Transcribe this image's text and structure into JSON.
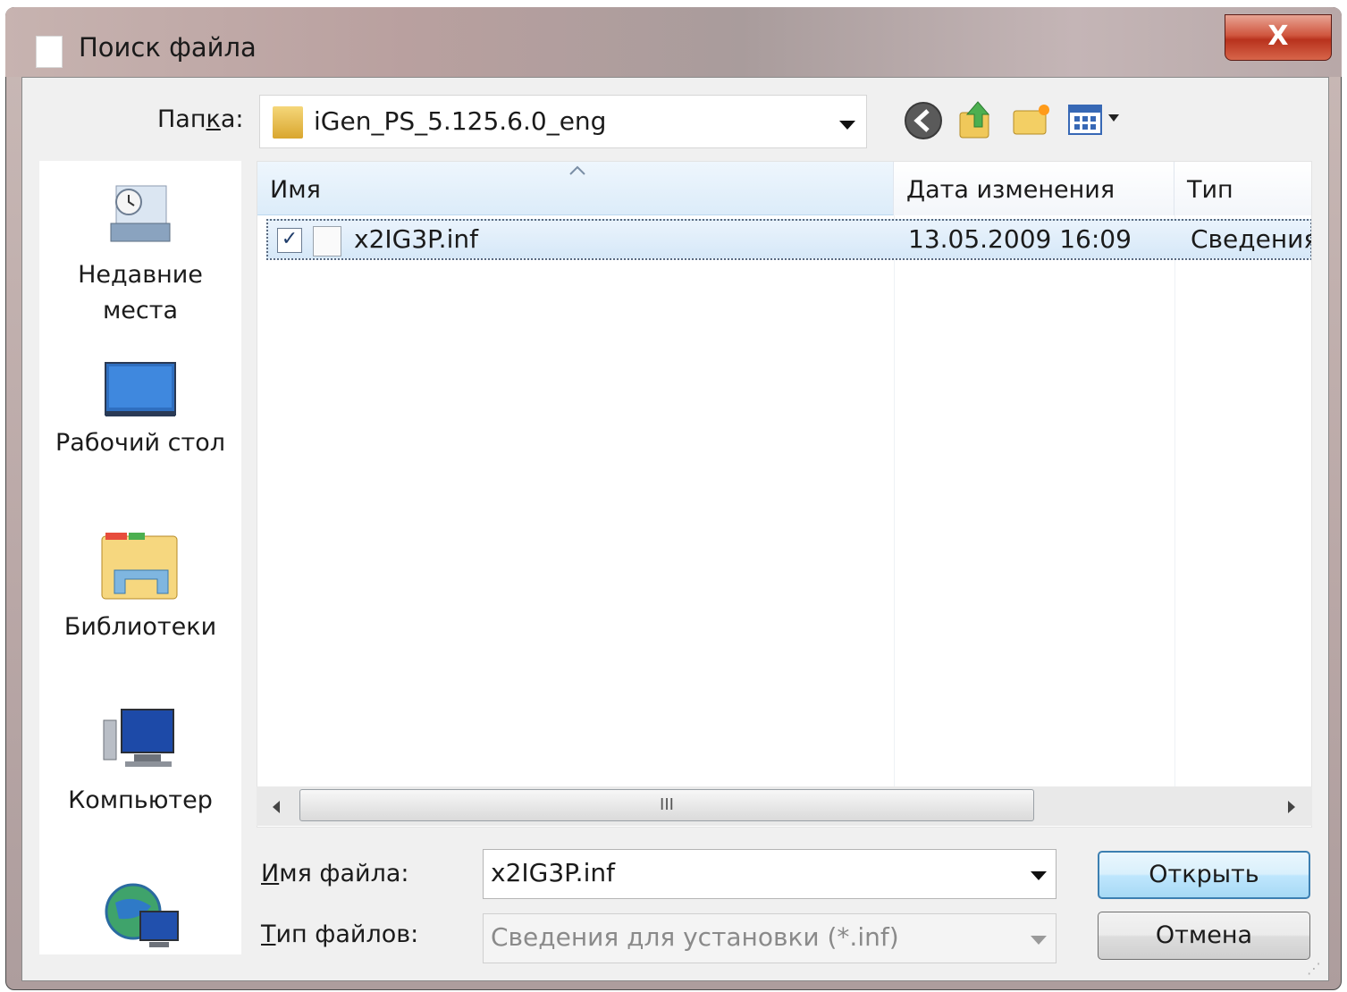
{
  "window": {
    "title": "Поиск файла",
    "close_label": "X"
  },
  "folder": {
    "label": "Папка:",
    "value": "iGen_PS_5.125.6.0_eng"
  },
  "toolbar": {
    "back_icon": "back-arrow-icon",
    "up_icon": "folder-up-icon",
    "new_folder_icon": "new-folder-icon",
    "views_icon": "view-menu-icon"
  },
  "places": [
    {
      "label": "Недавние места",
      "icon": "recent-places-icon"
    },
    {
      "label": "Рабочий стол",
      "icon": "desktop-icon"
    },
    {
      "label": "Библиотеки",
      "icon": "libraries-icon"
    },
    {
      "label": "Компьютер",
      "icon": "computer-icon"
    },
    {
      "label": "",
      "icon": "network-icon"
    }
  ],
  "list": {
    "columns": [
      "Имя",
      "Дата изменения",
      "Тип"
    ],
    "rows": [
      {
        "name": "x2IG3P.inf",
        "modified": "13.05.2009 16:09",
        "type": "Сведения",
        "checked": true
      }
    ],
    "scroll_grip": "III"
  },
  "filename": {
    "label": "Имя файла:",
    "value": "x2IG3P.inf"
  },
  "filetype": {
    "label": "Тип файлов:",
    "value": "Сведения для установки (*.inf)"
  },
  "buttons": {
    "open": "Открыть",
    "cancel": "Отмена"
  },
  "colors": {
    "selection": "#d6e8f8",
    "default_button_border": "#3c7fb1",
    "close_button": "#c8432b"
  }
}
